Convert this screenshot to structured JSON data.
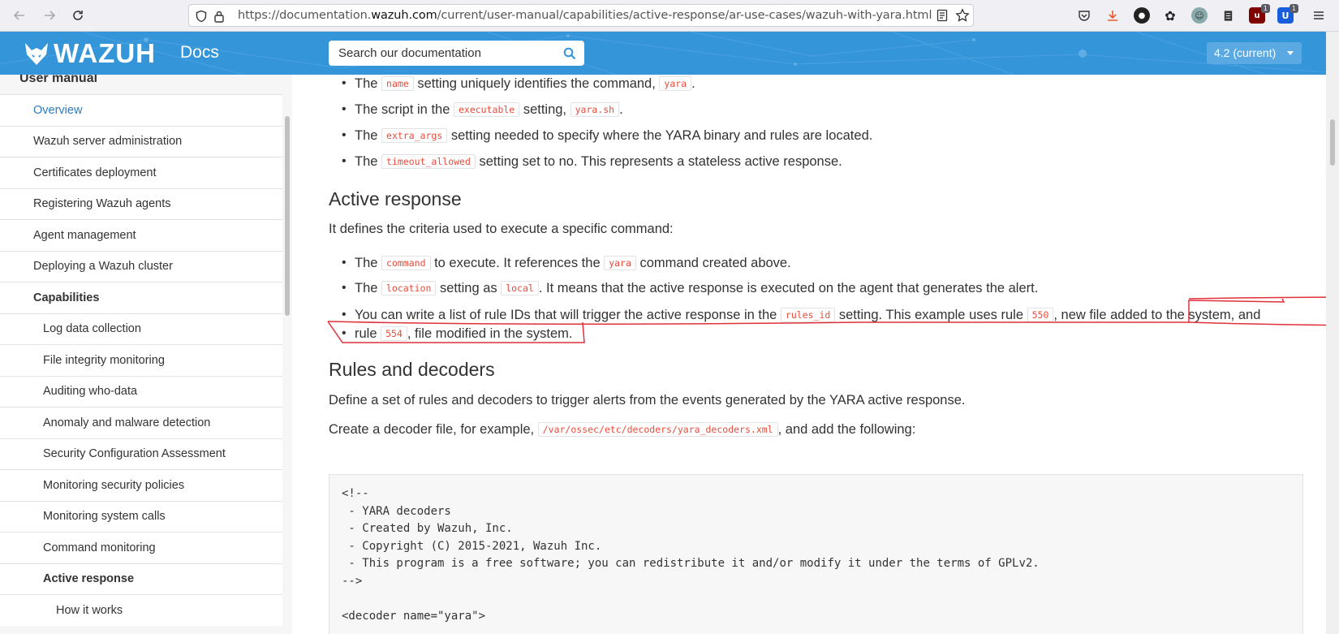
{
  "browser": {
    "url_prefix": "https://documentation.",
    "url_domain": "wazuh.com",
    "url_path": "/current/user-manual/capabilities/active-response/ar-use-cases/wazuh-with-yara.html",
    "ext_badge_1": "1",
    "ext_badge_2": "1"
  },
  "header": {
    "logo_text": "WAZUH",
    "docs_label": "Docs",
    "search_placeholder": "Search our documentation",
    "version_label": "4.2 (current)",
    "colors": {
      "header_bg": "#3595d9",
      "version_bg": "#5aa9e2"
    }
  },
  "sidebar": {
    "heading": "User manual",
    "items": [
      {
        "label": "Overview"
      },
      {
        "label": "Wazuh server administration"
      },
      {
        "label": "Certificates deployment"
      },
      {
        "label": "Registering Wazuh agents"
      },
      {
        "label": "Agent management"
      },
      {
        "label": "Deploying a Wazuh cluster"
      },
      {
        "label": "Capabilities"
      },
      {
        "label": "Log data collection"
      },
      {
        "label": "File integrity monitoring"
      },
      {
        "label": "Auditing who-data"
      },
      {
        "label": "Anomaly and malware detection"
      },
      {
        "label": "Security Configuration Assessment"
      },
      {
        "label": "Monitoring security policies"
      },
      {
        "label": "Monitoring system calls"
      },
      {
        "label": "Command monitoring"
      },
      {
        "label": "Active response"
      },
      {
        "label": "How it works"
      }
    ]
  },
  "content": {
    "command_bullets": [
      {
        "pre": "The ",
        "code": "name",
        "mid": " setting uniquely identifies the command, ",
        "code2": "yara",
        "post": "."
      },
      {
        "pre": "The script in the ",
        "code": "executable",
        "mid": " setting, ",
        "code2": "yara.sh",
        "post": "."
      },
      {
        "pre": "The ",
        "code": "extra_args",
        "post": " setting needed to specify where the YARA binary and rules are located."
      },
      {
        "pre": "The ",
        "code": "timeout_allowed",
        "post": " setting set to no. This represents a stateless active response."
      }
    ],
    "active_response_heading": "Active response",
    "active_response_intro": "It defines the criteria used to execute a specific command:",
    "ar_bullets": [
      {
        "pre": "The ",
        "code": "command",
        "mid": " to execute. It references the ",
        "code2": "yara",
        "post": " command created above."
      },
      {
        "pre": "The ",
        "code": "location",
        "mid": " setting as ",
        "code2": "local",
        "post": ". It means that the active response is executed on the agent that generates the alert."
      },
      {
        "pre": "You can write a list of rule IDs that will trigger the active response in the ",
        "code": "rules_id",
        "mid": " setting. This example uses rule ",
        "code2": "550",
        "post": ", new file added to the system, and",
        "line2_pre": "rule ",
        "line2_code": "554",
        "line2_post": ", file modified in the system."
      }
    ],
    "rules_heading": "Rules and decoders",
    "rules_intro": "Define a set of rules and decoders to trigger alerts from the events generated by the YARA active response.",
    "decoder_para": {
      "pre": "Create a decoder file, for example, ",
      "code": "/var/ossec/etc/decoders/yara_decoders.xml",
      "post": ", and add the following:"
    },
    "code_lines": [
      "<!--",
      " - YARA decoders",
      " - Created by Wazuh, Inc.",
      " - Copyright (C) 2015-2021, Wazuh Inc.",
      " - This program is a free software; you can redistribute it and/or modify it under the terms of GPLv2.",
      "-->",
      "",
      "<decoder name=\"yara\">"
    ]
  }
}
